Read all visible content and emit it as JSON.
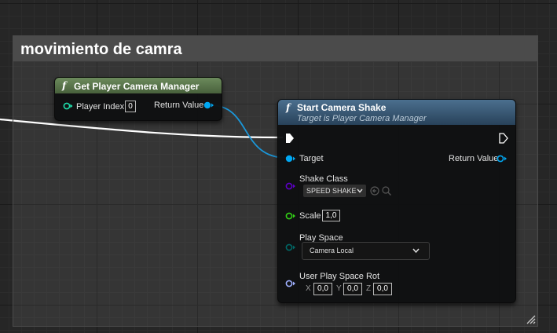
{
  "comment": {
    "title": "movimiento de camra"
  },
  "get_camera_manager": {
    "title": "Get Player Camera Manager",
    "player_index_label": "Player Index",
    "player_index_value": "0",
    "return_label": "Return Value"
  },
  "start_camera_shake": {
    "title": "Start Camera Shake",
    "subtitle": "Target is Player Camera Manager",
    "target_label": "Target",
    "return_label": "Return Value",
    "shake_class_label": "Shake Class",
    "shake_class_value": "SPEED SHAKE",
    "scale_label": "Scale",
    "scale_value": "1,0",
    "play_space_label": "Play Space",
    "play_space_value": "Camera Local",
    "rot_label": "User Play Space Rot",
    "rot_x_label": "X",
    "rot_x": "0,0",
    "rot_y_label": "Y",
    "rot_y": "0,0",
    "rot_z_label": "Z",
    "rot_z": "0,0"
  },
  "colors": {
    "object_pin": "#00a8f3",
    "int_pin": "#1fe0ad",
    "float_pin": "#33d116",
    "class_pin": "#5e00c8",
    "enum_pin": "#006866",
    "rotator_pin": "#9fb0ff",
    "exec_pin": "#ffffff",
    "pure_header": "#5c7a4e",
    "call_header": "#3b5f7d"
  },
  "icons": [
    "function-icon",
    "exec-pin-icon",
    "chevron-down-icon",
    "browse-icon",
    "search-icon",
    "resize-grip-icon"
  ]
}
